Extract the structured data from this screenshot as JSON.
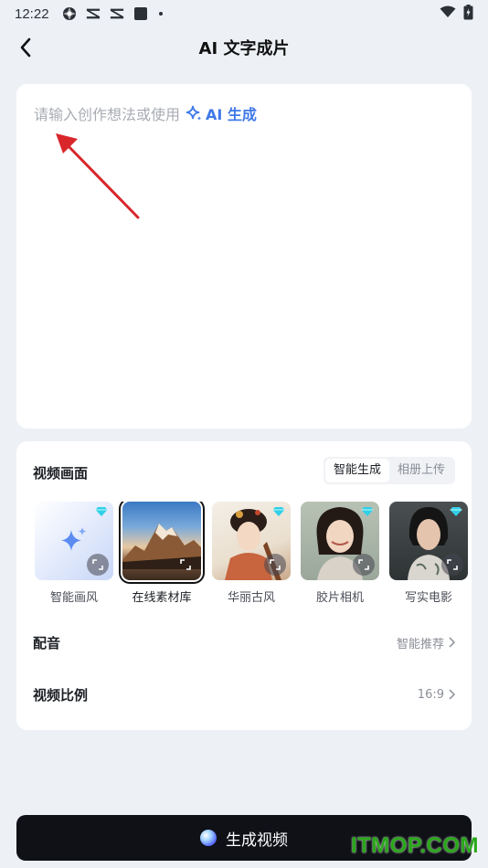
{
  "status_bar": {
    "time": "12:22",
    "icons": [
      "system-icon",
      "capcut-icon",
      "capcut-icon",
      "square-icon",
      "dot-icon"
    ],
    "right_icons": [
      "wifi-icon",
      "battery-icon"
    ]
  },
  "nav": {
    "back_icon": "back-arrow-icon",
    "title": "AI 文字成片"
  },
  "prompt": {
    "placeholder": "请输入创作想法或使用",
    "ai_generate_label": "AI 生成",
    "accent": "#3f78e8"
  },
  "video_frame": {
    "title": "视频画面",
    "modes": [
      "智能生成",
      "相册上传"
    ],
    "active_mode": "智能生成",
    "styles": [
      {
        "label": "智能画风",
        "selected": false,
        "premium": true
      },
      {
        "label": "在线素材库",
        "selected": true,
        "premium": false
      },
      {
        "label": "华丽古风",
        "selected": false,
        "premium": true
      },
      {
        "label": "胶片相机",
        "selected": false,
        "premium": true
      },
      {
        "label": "写实电影",
        "selected": false,
        "premium": true
      }
    ]
  },
  "dubbing": {
    "label": "配音",
    "value": "智能推荐"
  },
  "ratio": {
    "label": "视频比例",
    "value": "16:9"
  },
  "generate_button": {
    "label": "生成视频"
  },
  "watermark": "ITMOP.COM"
}
